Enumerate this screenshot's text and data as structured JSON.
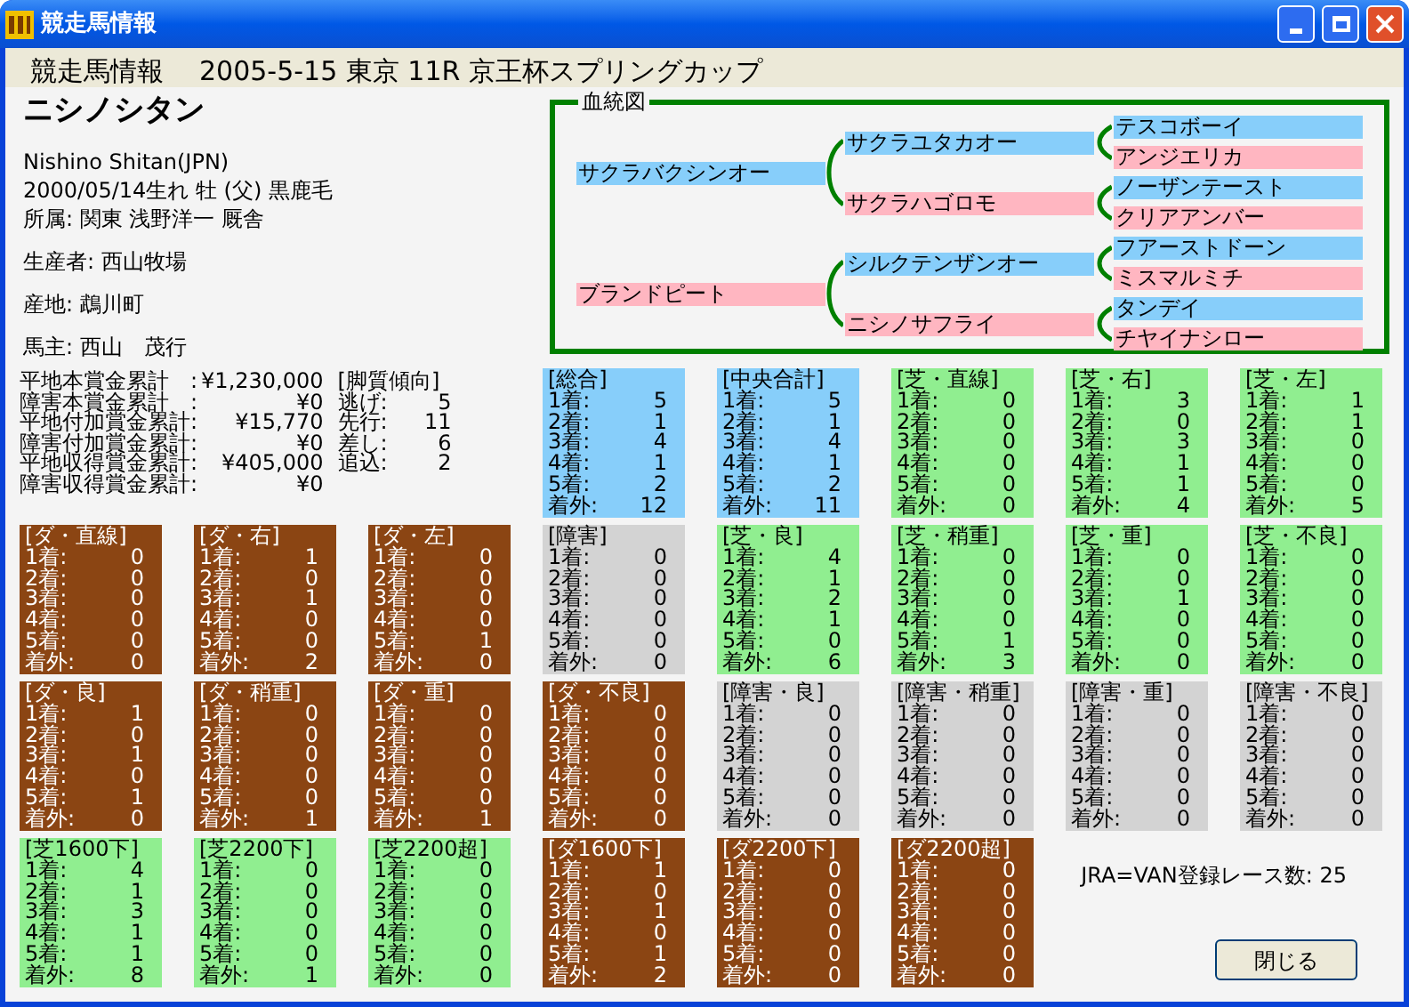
{
  "window": {
    "title": "競走馬情報"
  },
  "header": {
    "title": "競走馬情報",
    "race": "2005-5-15 東京 11R 京王杯スプリングカップ"
  },
  "horse": {
    "name": "ニシノシタン",
    "name_en": "Nishino Shitan(JPN)",
    "birth": "2000/05/14生れ 牡 (父) 黒鹿毛",
    "affiliation": "所属: 関東 浅野洋一 厩舎",
    "breeder": "生産者: 西山牧場",
    "birthplace": "産地: 鵡川町",
    "owner": "馬主: 西山　茂行"
  },
  "prizes": [
    {
      "label": "平地本賞金累計　:",
      "value": "¥1,230,000"
    },
    {
      "label": "障害本賞金累計　:",
      "value": "¥0"
    },
    {
      "label": "平地付加賞金累計:",
      "value": "¥15,770"
    },
    {
      "label": "障害付加賞金累計:",
      "value": "¥0"
    },
    {
      "label": "平地収得賞金累計:",
      "value": "¥405,000"
    },
    {
      "label": "障害収得賞金累計:",
      "value": "¥0"
    }
  ],
  "running_style": {
    "title": "[脚質傾向]",
    "items": [
      {
        "label": "逃げ:",
        "value": "5"
      },
      {
        "label": "先行:",
        "value": "11"
      },
      {
        "label": "差し:",
        "value": "6"
      },
      {
        "label": "追込:",
        "value": "2"
      }
    ]
  },
  "pedigree": {
    "title": "血統図",
    "children": [
      {
        "name": "サクラバクシンオー",
        "color": "#87cefa",
        "children": [
          {
            "name": "サクラユタカオー",
            "color": "#87cefa",
            "children": [
              {
                "name": "テスコボーイ",
                "color": "#87cefa"
              },
              {
                "name": "アンジエリカ",
                "color": "#ffb6c1"
              }
            ]
          },
          {
            "name": "サクラハゴロモ",
            "color": "#ffb6c1",
            "children": [
              {
                "name": "ノーザンテースト",
                "color": "#87cefa"
              },
              {
                "name": "クリアアンバー",
                "color": "#ffb6c1"
              }
            ]
          }
        ]
      },
      {
        "name": "ブランドピート",
        "color": "#ffb6c1",
        "children": [
          {
            "name": "シルクテンザンオー",
            "color": "#87cefa",
            "children": [
              {
                "name": "フアーストドーン",
                "color": "#87cefa"
              },
              {
                "name": "ミスマルミチ",
                "color": "#ffb6c1"
              }
            ]
          },
          {
            "name": "ニシノサフライ",
            "color": "#ffb6c1",
            "children": [
              {
                "name": "タンデイ",
                "color": "#87cefa"
              },
              {
                "name": "チヤイナシロー",
                "color": "#ffb6c1"
              }
            ]
          }
        ]
      }
    ]
  },
  "stat_cards": [
    {
      "kind": "total",
      "title": "[総合]",
      "rows": [
        [
          "1着:",
          "5"
        ],
        [
          "2着:",
          "1"
        ],
        [
          "3着:",
          "4"
        ],
        [
          "4着:",
          "1"
        ],
        [
          "5着:",
          "2"
        ],
        [
          "着外:",
          "12"
        ]
      ]
    },
    {
      "kind": "total",
      "title": "[中央合計]",
      "rows": [
        [
          "1着:",
          "5"
        ],
        [
          "2着:",
          "1"
        ],
        [
          "3着:",
          "4"
        ],
        [
          "4着:",
          "1"
        ],
        [
          "5着:",
          "2"
        ],
        [
          "着外:",
          "11"
        ]
      ]
    },
    {
      "kind": "turf",
      "title": "[芝・直線]",
      "rows": [
        [
          "1着:",
          "0"
        ],
        [
          "2着:",
          "0"
        ],
        [
          "3着:",
          "0"
        ],
        [
          "4着:",
          "0"
        ],
        [
          "5着:",
          "0"
        ],
        [
          "着外:",
          "0"
        ]
      ]
    },
    {
      "kind": "turf",
      "title": "[芝・右]",
      "rows": [
        [
          "1着:",
          "3"
        ],
        [
          "2着:",
          "0"
        ],
        [
          "3着:",
          "3"
        ],
        [
          "4着:",
          "1"
        ],
        [
          "5着:",
          "1"
        ],
        [
          "着外:",
          "4"
        ]
      ]
    },
    {
      "kind": "turf",
      "title": "[芝・左]",
      "rows": [
        [
          "1着:",
          "1"
        ],
        [
          "2着:",
          "1"
        ],
        [
          "3着:",
          "0"
        ],
        [
          "4着:",
          "0"
        ],
        [
          "5着:",
          "0"
        ],
        [
          "着外:",
          "5"
        ]
      ]
    },
    {
      "kind": "dirt",
      "title": "[ダ・直線]",
      "rows": [
        [
          "1着:",
          "0"
        ],
        [
          "2着:",
          "0"
        ],
        [
          "3着:",
          "0"
        ],
        [
          "4着:",
          "0"
        ],
        [
          "5着:",
          "0"
        ],
        [
          "着外:",
          "0"
        ]
      ]
    },
    {
      "kind": "dirt",
      "title": "[ダ・右]",
      "rows": [
        [
          "1着:",
          "1"
        ],
        [
          "2着:",
          "0"
        ],
        [
          "3着:",
          "1"
        ],
        [
          "4着:",
          "0"
        ],
        [
          "5着:",
          "0"
        ],
        [
          "着外:",
          "2"
        ]
      ]
    },
    {
      "kind": "dirt",
      "title": "[ダ・左]",
      "rows": [
        [
          "1着:",
          "0"
        ],
        [
          "2着:",
          "0"
        ],
        [
          "3着:",
          "0"
        ],
        [
          "4着:",
          "0"
        ],
        [
          "5着:",
          "1"
        ],
        [
          "着外:",
          "0"
        ]
      ]
    },
    {
      "kind": "hurdle",
      "title": "[障害]",
      "rows": [
        [
          "1着:",
          "0"
        ],
        [
          "2着:",
          "0"
        ],
        [
          "3着:",
          "0"
        ],
        [
          "4着:",
          "0"
        ],
        [
          "5着:",
          "0"
        ],
        [
          "着外:",
          "0"
        ]
      ]
    },
    {
      "kind": "turf",
      "title": "[芝・良]",
      "rows": [
        [
          "1着:",
          "4"
        ],
        [
          "2着:",
          "1"
        ],
        [
          "3着:",
          "2"
        ],
        [
          "4着:",
          "1"
        ],
        [
          "5着:",
          "0"
        ],
        [
          "着外:",
          "6"
        ]
      ]
    },
    {
      "kind": "turf",
      "title": "[芝・稍重]",
      "rows": [
        [
          "1着:",
          "0"
        ],
        [
          "2着:",
          "0"
        ],
        [
          "3着:",
          "0"
        ],
        [
          "4着:",
          "0"
        ],
        [
          "5着:",
          "1"
        ],
        [
          "着外:",
          "3"
        ]
      ]
    },
    {
      "kind": "turf",
      "title": "[芝・重]",
      "rows": [
        [
          "1着:",
          "0"
        ],
        [
          "2着:",
          "0"
        ],
        [
          "3着:",
          "1"
        ],
        [
          "4着:",
          "0"
        ],
        [
          "5着:",
          "0"
        ],
        [
          "着外:",
          "0"
        ]
      ]
    },
    {
      "kind": "turf",
      "title": "[芝・不良]",
      "rows": [
        [
          "1着:",
          "0"
        ],
        [
          "2着:",
          "0"
        ],
        [
          "3着:",
          "0"
        ],
        [
          "4着:",
          "0"
        ],
        [
          "5着:",
          "0"
        ],
        [
          "着外:",
          "0"
        ]
      ]
    },
    {
      "kind": "dirt",
      "title": "[ダ・良]",
      "rows": [
        [
          "1着:",
          "1"
        ],
        [
          "2着:",
          "0"
        ],
        [
          "3着:",
          "1"
        ],
        [
          "4着:",
          "0"
        ],
        [
          "5着:",
          "1"
        ],
        [
          "着外:",
          "0"
        ]
      ]
    },
    {
      "kind": "dirt",
      "title": "[ダ・稍重]",
      "rows": [
        [
          "1着:",
          "0"
        ],
        [
          "2着:",
          "0"
        ],
        [
          "3着:",
          "0"
        ],
        [
          "4着:",
          "0"
        ],
        [
          "5着:",
          "0"
        ],
        [
          "着外:",
          "1"
        ]
      ]
    },
    {
      "kind": "dirt",
      "title": "[ダ・重]",
      "rows": [
        [
          "1着:",
          "0"
        ],
        [
          "2着:",
          "0"
        ],
        [
          "3着:",
          "0"
        ],
        [
          "4着:",
          "0"
        ],
        [
          "5着:",
          "0"
        ],
        [
          "着外:",
          "1"
        ]
      ]
    },
    {
      "kind": "dirt",
      "title": "[ダ・不良]",
      "rows": [
        [
          "1着:",
          "0"
        ],
        [
          "2着:",
          "0"
        ],
        [
          "3着:",
          "0"
        ],
        [
          "4着:",
          "0"
        ],
        [
          "5着:",
          "0"
        ],
        [
          "着外:",
          "0"
        ]
      ]
    },
    {
      "kind": "hurdle",
      "title": "[障害・良]",
      "rows": [
        [
          "1着:",
          "0"
        ],
        [
          "2着:",
          "0"
        ],
        [
          "3着:",
          "0"
        ],
        [
          "4着:",
          "0"
        ],
        [
          "5着:",
          "0"
        ],
        [
          "着外:",
          "0"
        ]
      ]
    },
    {
      "kind": "hurdle",
      "title": "[障害・稍重]",
      "rows": [
        [
          "1着:",
          "0"
        ],
        [
          "2着:",
          "0"
        ],
        [
          "3着:",
          "0"
        ],
        [
          "4着:",
          "0"
        ],
        [
          "5着:",
          "0"
        ],
        [
          "着外:",
          "0"
        ]
      ]
    },
    {
      "kind": "hurdle",
      "title": "[障害・重]",
      "rows": [
        [
          "1着:",
          "0"
        ],
        [
          "2着:",
          "0"
        ],
        [
          "3着:",
          "0"
        ],
        [
          "4着:",
          "0"
        ],
        [
          "5着:",
          "0"
        ],
        [
          "着外:",
          "0"
        ]
      ]
    },
    {
      "kind": "hurdle",
      "title": "[障害・不良]",
      "rows": [
        [
          "1着:",
          "0"
        ],
        [
          "2着:",
          "0"
        ],
        [
          "3着:",
          "0"
        ],
        [
          "4着:",
          "0"
        ],
        [
          "5着:",
          "0"
        ],
        [
          "着外:",
          "0"
        ]
      ]
    },
    {
      "kind": "turf",
      "title": "[芝1600下]",
      "rows": [
        [
          "1着:",
          "4"
        ],
        [
          "2着:",
          "1"
        ],
        [
          "3着:",
          "3"
        ],
        [
          "4着:",
          "1"
        ],
        [
          "5着:",
          "1"
        ],
        [
          "着外:",
          "8"
        ]
      ]
    },
    {
      "kind": "turf",
      "title": "[芝2200下]",
      "rows": [
        [
          "1着:",
          "0"
        ],
        [
          "2着:",
          "0"
        ],
        [
          "3着:",
          "0"
        ],
        [
          "4着:",
          "0"
        ],
        [
          "5着:",
          "0"
        ],
        [
          "着外:",
          "1"
        ]
      ]
    },
    {
      "kind": "turf",
      "title": "[芝2200超]",
      "rows": [
        [
          "1着:",
          "0"
        ],
        [
          "2着:",
          "0"
        ],
        [
          "3着:",
          "0"
        ],
        [
          "4着:",
          "0"
        ],
        [
          "5着:",
          "0"
        ],
        [
          "着外:",
          "0"
        ]
      ]
    },
    {
      "kind": "dirt",
      "title": "[ダ1600下]",
      "rows": [
        [
          "1着:",
          "1"
        ],
        [
          "2着:",
          "0"
        ],
        [
          "3着:",
          "1"
        ],
        [
          "4着:",
          "0"
        ],
        [
          "5着:",
          "1"
        ],
        [
          "着外:",
          "2"
        ]
      ]
    },
    {
      "kind": "dirt",
      "title": "[ダ2200下]",
      "rows": [
        [
          "1着:",
          "0"
        ],
        [
          "2着:",
          "0"
        ],
        [
          "3着:",
          "0"
        ],
        [
          "4着:",
          "0"
        ],
        [
          "5着:",
          "0"
        ],
        [
          "着外:",
          "0"
        ]
      ]
    },
    {
      "kind": "dirt",
      "title": "[ダ2200超]",
      "rows": [
        [
          "1着:",
          "0"
        ],
        [
          "2着:",
          "0"
        ],
        [
          "3着:",
          "0"
        ],
        [
          "4着:",
          "0"
        ],
        [
          "5着:",
          "0"
        ],
        [
          "着外:",
          "0"
        ]
      ]
    }
  ],
  "race_count": "JRA=VAN登録レース数: 25",
  "buttons": [
    {
      "label": "閉じる"
    }
  ]
}
